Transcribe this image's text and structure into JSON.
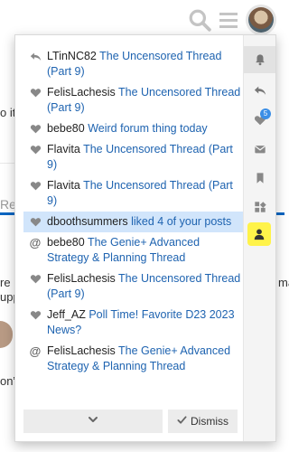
{
  "background": {
    "fragments": [
      "o it",
      "Re",
      "re",
      "upp",
      "mat",
      "on”"
    ]
  },
  "header": {
    "search_icon": "search-icon",
    "menu_icon": "hamburger-icon",
    "avatar_icon": "user-avatar"
  },
  "notifications": [
    {
      "icon": "reply-icon",
      "user": "LTinNC82",
      "link": "The Uncensored Thread (Part 9)",
      "highlight": false
    },
    {
      "icon": "heart-icon",
      "user": "FelisLachesis",
      "link": "The Uncensored Thread (Part 9)",
      "highlight": false
    },
    {
      "icon": "heart-icon",
      "user": "bebe80",
      "link": "Weird forum thing today",
      "highlight": false
    },
    {
      "icon": "heart-icon",
      "user": "Flavita",
      "link": "The Uncensored Thread (Part 9)",
      "highlight": false
    },
    {
      "icon": "heart-icon",
      "user": "Flavita",
      "link": "The Uncensored Thread (Part 9)",
      "highlight": false
    },
    {
      "icon": "heart-icon",
      "user": "dboothsummers",
      "link": "liked 4 of your posts",
      "highlight": true
    },
    {
      "icon": "at-icon",
      "user": "bebe80",
      "link": "The Genie+ Advanced Strategy & Planning Thread",
      "highlight": false
    },
    {
      "icon": "heart-icon",
      "user": "FelisLachesis",
      "link": "The Uncensored Thread (Part 9)",
      "highlight": false
    },
    {
      "icon": "heart-icon",
      "user": "Jeff_AZ",
      "link": "Poll Time! Favorite D23 2023 News?",
      "highlight": false
    },
    {
      "icon": "at-icon",
      "user": "FelisLachesis",
      "link": "The Genie+ Advanced Strategy & Planning Thread",
      "highlight": false
    }
  ],
  "rail": {
    "items": [
      {
        "name": "bell-icon",
        "active": true
      },
      {
        "name": "reply-icon",
        "active": false
      },
      {
        "name": "heart-icon",
        "badge": "5",
        "active": false
      },
      {
        "name": "envelope-icon",
        "active": false
      },
      {
        "name": "bookmark-icon",
        "active": false
      },
      {
        "name": "grid-icon",
        "active": false
      },
      {
        "name": "profile-icon",
        "active": false
      }
    ]
  },
  "footer": {
    "expand_icon": "chevron-down-icon",
    "dismiss_label": "Dismiss",
    "dismiss_icon": "check-icon"
  },
  "colors": {
    "link": "#1e63b0",
    "highlight": "#d1e5fb",
    "badge": "#3b8ee6",
    "profile_highlight": "#fff34a",
    "accent_bar": "#0a66c2"
  }
}
